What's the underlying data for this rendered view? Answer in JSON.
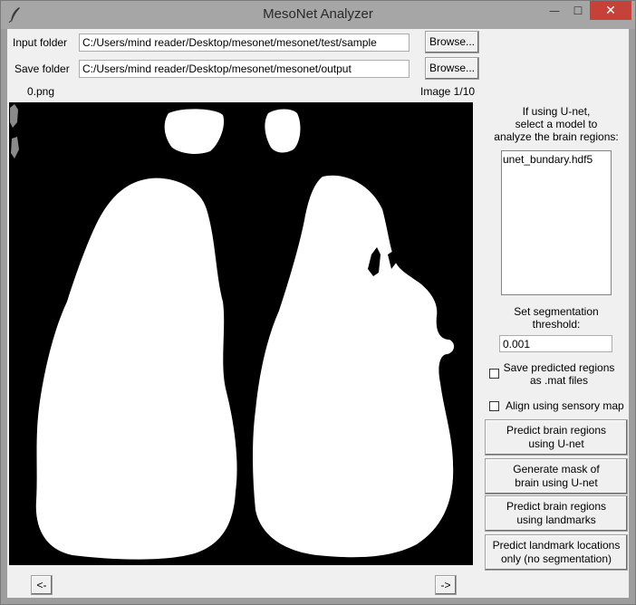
{
  "window": {
    "title": "MesoNet Analyzer",
    "minimize_glyph": "—",
    "maximize_glyph": "☐",
    "close_glyph": "✕",
    "app_icon": "feather-icon"
  },
  "folders": {
    "input_label": "Input folder",
    "input_value": "C:/Users/mind reader/Desktop/mesonet/mesonet/test/sample",
    "save_label": "Save folder",
    "save_value": "C:/Users/mind reader/Desktop/mesonet/mesonet/output",
    "browse_label": "Browse..."
  },
  "viewer": {
    "filename": "0.png",
    "image_counter": "Image 1/10",
    "prev_label": "<-",
    "next_label": "->"
  },
  "sidebar": {
    "model_prompt_line1": "If using U-net,",
    "model_prompt_line2": "select a model to",
    "model_prompt_line3": "analyze the brain regions:",
    "models": [
      "unet_bundary.hdf5"
    ],
    "threshold_label_line1": "Set segmentation",
    "threshold_label_line2": "threshold:",
    "threshold_value": "0.001",
    "save_mat_line1": "Save predicted regions",
    "save_mat_line2": "as .mat files",
    "align_label": "Align using sensory map",
    "save_mat_checked": false,
    "align_checked": false
  },
  "actions": {
    "predict_unet_line1": "Predict brain regions",
    "predict_unet_line2": "using U-net",
    "mask_line1": "Generate mask of",
    "mask_line2": "brain using U-net",
    "landmark_regions_line1": "Predict brain regions",
    "landmark_regions_line2": "using landmarks",
    "landmark_loc_line1": "Predict landmark locations",
    "landmark_loc_line2": "only (no segmentation)"
  }
}
